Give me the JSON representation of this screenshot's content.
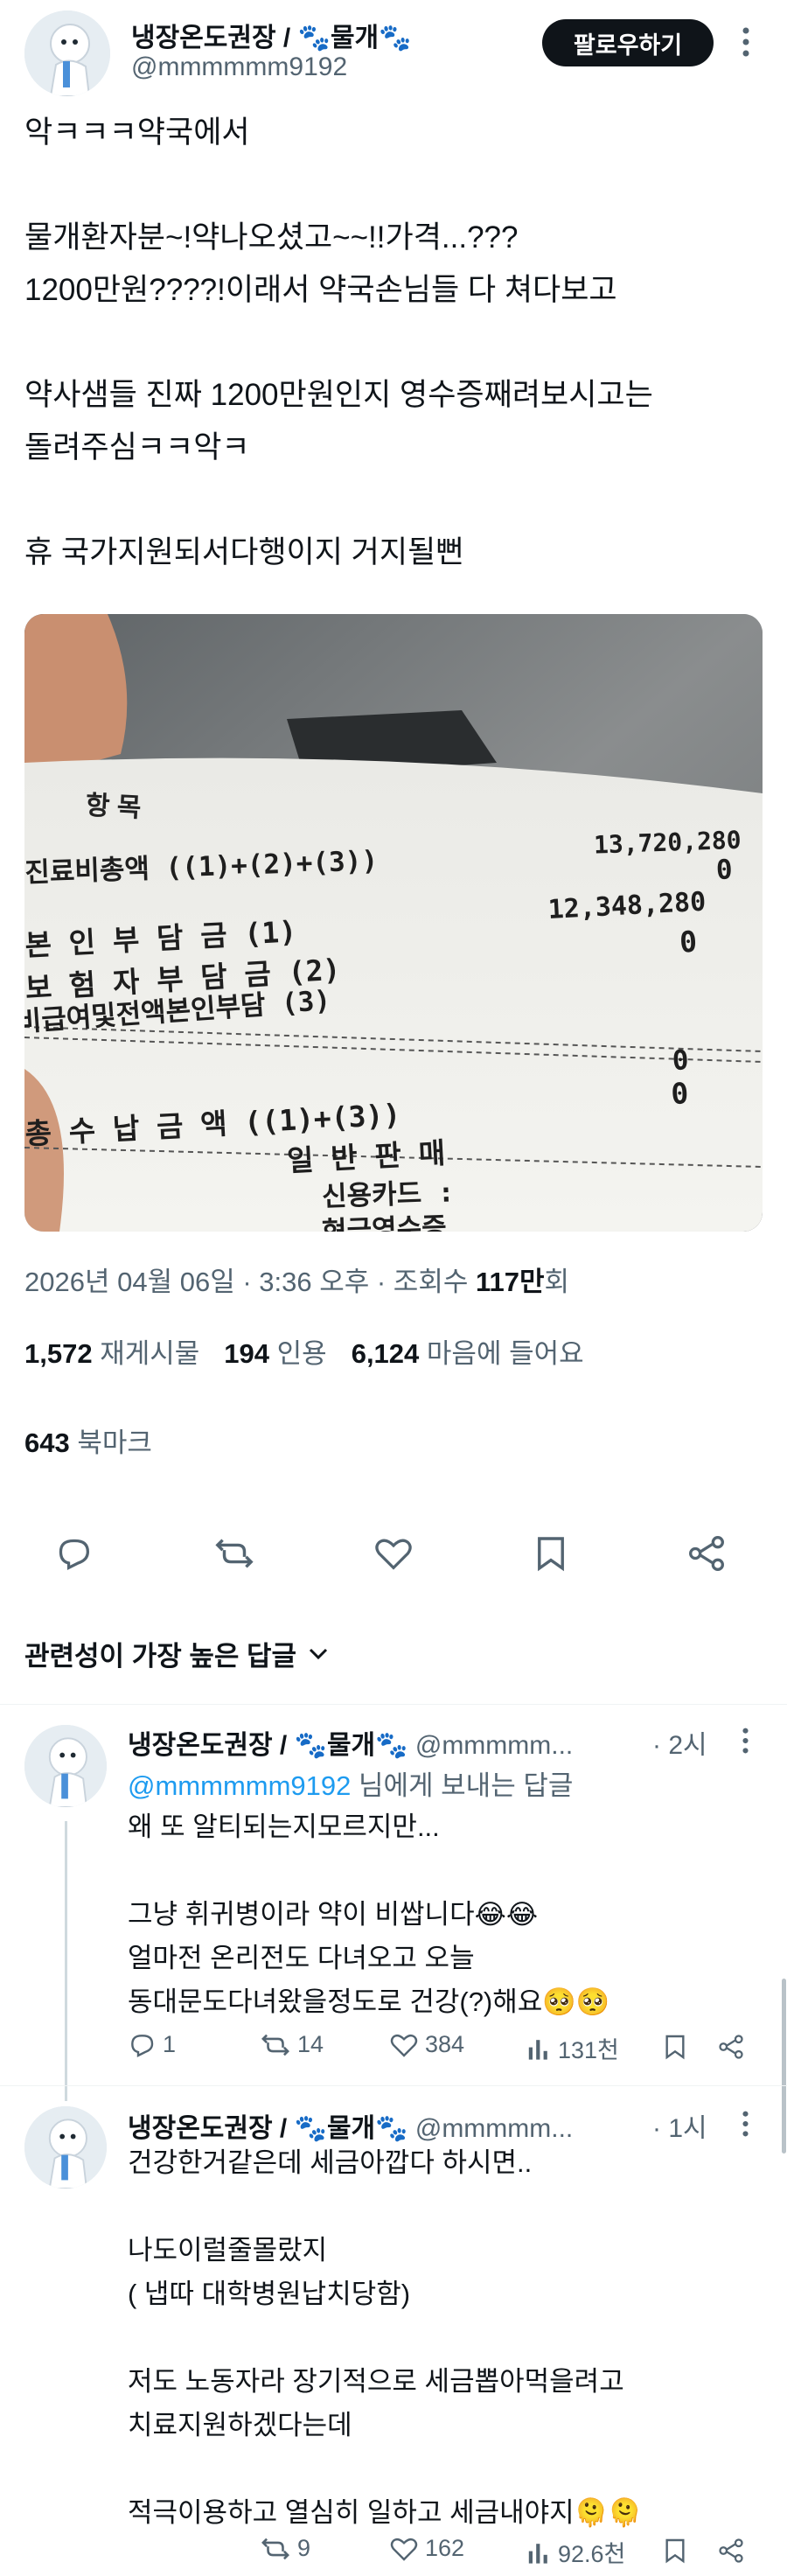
{
  "post": {
    "author_name": "냉장온도권장 / 🐾물개🐾",
    "author_handle": "@mmmmmm9192",
    "follow_label": "팔로우하기",
    "text": "악ㅋㅋㅋ약국에서\n\n물개환자분~!약나오셨고~~!!가격...???\n1200만원????!이래서 약국손님들 다 쳐다보고\n\n약사샘들 진짜 1200만원인지 영수증째려보시고는\n돌려주심ㅋㅋ악ㅋ\n\n휴 국가지원되서다행이지 거지될뻔",
    "timestamp": "2026년 04월 06일 · 3:36 오후 · 조회수 ",
    "views": "117만",
    "views_suffix": "회",
    "reposts_num": "1,572",
    "reposts_label": "재게시물",
    "quotes_num": "194",
    "quotes_label": "인용",
    "likes_num": "6,124",
    "likes_label": "마음에 들어요",
    "bookmarks_num": "643",
    "bookmarks_label": "북마크"
  },
  "receipt": {
    "title": "항 목",
    "rows": [
      {
        "label": "진료비총액 ((1)+(2)+(3))",
        "value": "13,720,280"
      },
      {
        "label": "",
        "value": "0"
      },
      {
        "label": "본 인 부 담 금 (1)",
        "value": "12,348,280"
      },
      {
        "label": "보 험 자 부 담 금 (2)",
        "value": "0"
      },
      {
        "label": "비급여및전액본인부담 (3)",
        "value": ""
      },
      {
        "label": "",
        "value": "0"
      },
      {
        "label": "총 수 납 금 액 ((1)+(3))",
        "value": "0"
      },
      {
        "label": "일 반 판 매",
        "value": ""
      },
      {
        "label": "신용카드 :",
        "value": ""
      },
      {
        "label": "현금영수증",
        "value": ""
      }
    ]
  },
  "sort": {
    "label": "관련성이 가장 높은 답글"
  },
  "replies": [
    {
      "author_name": "냉장온도권장 / 🐾물개🐾",
      "author_handle": "@mmmmm...",
      "time": "· 2시",
      "replying_to_handle": "@mmmmmm9192",
      "replying_to_suffix": " 님에게 보내는 답글",
      "text": "왜 또 알티되는지모르지만...\n\n그냥 휘귀병이라 약이 비쌉니다😂😂\n얼마전 온리전도 다녀오고 오늘\n동대문도다녀왔을정도로 건강(?)해요🥺🥺",
      "replies": "1",
      "reposts": "14",
      "likes": "384",
      "views": "131천"
    },
    {
      "author_name": "냉장온도권장 / 🐾물개🐾",
      "author_handle": "@mmmmm...",
      "time": "· 1시",
      "text": "건강한거같은데 세금아깝다 하시면..\n\n나도이럴줄몰랐지\n( 냅따 대학병원납치당함)\n\n 저도 노동자라 장기적으로 세금뽑아먹을려고\n치료지원하겠다는데\n\n적극이용하고 열심히 일하고 세금내야지🫠🫠",
      "reposts": "9",
      "likes": "162",
      "views": "92.6천"
    }
  ],
  "colors": {
    "accent": "#1d9bf0",
    "text": "#0f1419",
    "muted": "#536471"
  },
  "icons": [
    "reply-icon",
    "repost-icon",
    "like-icon",
    "bookmark-icon",
    "share-icon",
    "more-icon",
    "views-icon",
    "chevron-down-icon"
  ]
}
